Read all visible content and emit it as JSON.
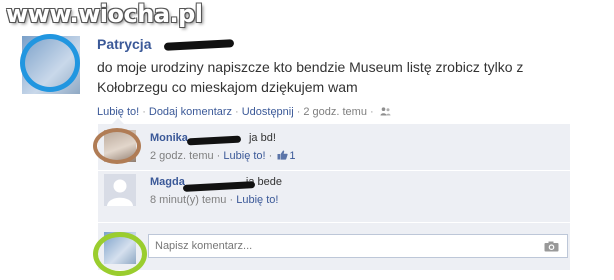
{
  "watermark": "www.wiocha.pl",
  "post": {
    "author": "Patrycja",
    "text": "do moje urodziny napiszcze kto bendzie Museum listę zrobicz tylko z Kołobrzegu co mieskajom dziękujem wam",
    "actions": {
      "like": "Lubię to!",
      "comment": "Dodaj komentarz",
      "share": "Udostępnij",
      "time": "2 godz. temu",
      "sep": "·"
    }
  },
  "comments": [
    {
      "author": "Monika",
      "text": "ja bd!",
      "time": "2 godz. temu",
      "like": "Lubię to!",
      "likes_count": "1"
    },
    {
      "author": "Magda",
      "text": "ja bede",
      "time": "8 minut(y) temu",
      "like": "Lubię to!"
    }
  ],
  "comment_input": {
    "placeholder": "Napisz komentarz..."
  },
  "colors": {
    "link": "#3b5998",
    "comment_bg": "#edeff4",
    "highlight_blue": "#2196e0",
    "highlight_brown": "#b07c55",
    "highlight_green": "#9acd2e"
  },
  "icons": [
    "people-icon",
    "thumbs-up-icon",
    "camera-icon",
    "default-avatar-icon"
  ]
}
